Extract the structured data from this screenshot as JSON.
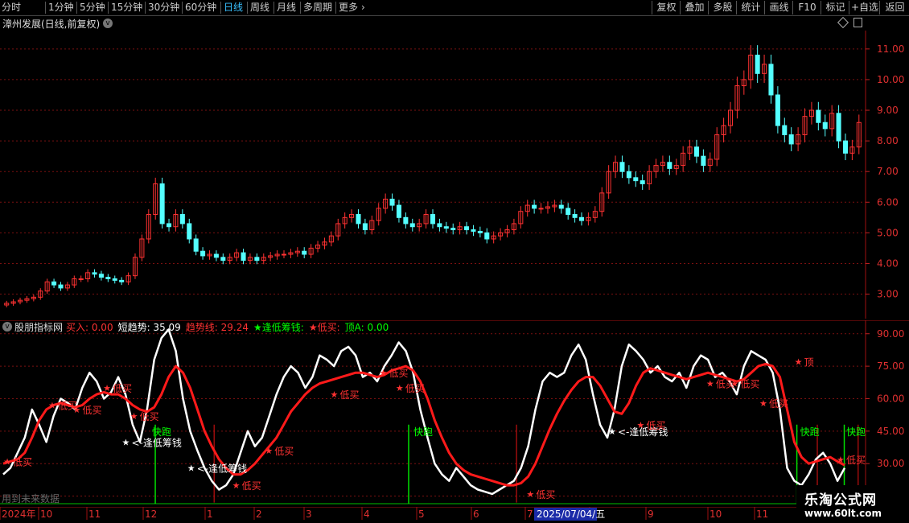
{
  "toolbar": {
    "periods": [
      "分时",
      "1分钟",
      "5分钟",
      "15分钟",
      "30分钟",
      "60分钟",
      "日线",
      "周线",
      "月线",
      "多周期",
      "更多"
    ],
    "active_period": "日线",
    "right_buttons": [
      "复权",
      "叠加",
      "多股",
      "统计",
      "画线",
      "F10",
      "标记",
      "+自选",
      "返回"
    ]
  },
  "main_chart": {
    "title": "漳州发展(日线,前复权)",
    "y_ticks": [
      "11.00",
      "10.00",
      "9.00",
      "8.00",
      "7.00",
      "6.00",
      "5.00",
      "4.00",
      "3.00"
    ],
    "y_range": [
      2.2,
      11.6
    ],
    "close_series": [
      2.7,
      2.75,
      2.8,
      2.85,
      2.9,
      3.1,
      3.4,
      3.3,
      3.2,
      3.3,
      3.5,
      3.5,
      3.7,
      3.65,
      3.55,
      3.5,
      3.45,
      3.4,
      3.6,
      4.2,
      4.8,
      5.6,
      6.6,
      5.3,
      5.2,
      5.6,
      5.3,
      4.8,
      4.4,
      4.25,
      4.3,
      4.2,
      4.1,
      4.2,
      4.35,
      4.1,
      4.2,
      4.1,
      4.2,
      4.25,
      4.3,
      4.3,
      4.35,
      4.4,
      4.3,
      4.5,
      4.6,
      4.7,
      4.9,
      5.3,
      5.5,
      5.6,
      5.3,
      5.1,
      5.4,
      5.8,
      6.1,
      5.9,
      5.5,
      5.3,
      5.2,
      5.3,
      5.6,
      5.3,
      5.2,
      5.15,
      5.1,
      5.2,
      5.1,
      5.05,
      5.0,
      4.8,
      4.9,
      5.0,
      5.1,
      5.3,
      5.7,
      5.9,
      5.8,
      5.8,
      5.85,
      5.9,
      5.8,
      5.6,
      5.5,
      5.4,
      5.5,
      5.7,
      6.3,
      7.0,
      7.3,
      7.0,
      6.8,
      6.7,
      6.6,
      7.0,
      7.2,
      7.3,
      7.1,
      7.2,
      7.6,
      7.8,
      7.5,
      7.2,
      7.4,
      8.2,
      8.5,
      9.0,
      9.8,
      10.0,
      10.8,
      10.2,
      10.5,
      9.5,
      8.5,
      8.2,
      7.9,
      8.2,
      8.8,
      9.0,
      8.6,
      8.4,
      8.9,
      8.0,
      7.6,
      7.8,
      8.6
    ],
    "candle_colors": {
      "up": "#ff3232",
      "down": "#54ffff"
    }
  },
  "indicator": {
    "name": "股朋指标网",
    "legend": [
      {
        "label": "买入: 0.00",
        "color": "#ff3232"
      },
      {
        "label": "短趋势: 35.09",
        "color": "#ffffff"
      },
      {
        "label": "趋势线: 29.24",
        "color": "#ff3232"
      },
      {
        "label": "★逢低筹钱:",
        "color": "#00ff00"
      },
      {
        "label": "★低买:",
        "color": "#ff3232"
      },
      {
        "label": "顶A: 0.00",
        "color": "#00ff00"
      }
    ],
    "y_ticks": [
      "90.00",
      "75.00",
      "60.00",
      "45.00",
      "30.00",
      "15.00"
    ],
    "y_range": [
      10,
      94
    ],
    "short_trend": [
      25,
      28,
      35,
      42,
      55,
      48,
      40,
      52,
      60,
      58,
      55,
      65,
      72,
      68,
      60,
      63,
      70,
      62,
      48,
      40,
      55,
      78,
      88,
      92,
      82,
      60,
      45,
      36,
      28,
      22,
      18,
      20,
      25,
      35,
      45,
      38,
      42,
      52,
      62,
      70,
      75,
      72,
      65,
      70,
      80,
      78,
      75,
      82,
      84,
      80,
      70,
      72,
      68,
      75,
      80,
      86,
      82,
      72,
      55,
      42,
      30,
      25,
      22,
      28,
      24,
      20,
      18,
      17,
      16,
      18,
      20,
      22,
      28,
      38,
      55,
      68,
      72,
      70,
      72,
      80,
      85,
      78,
      62,
      48,
      42,
      55,
      75,
      85,
      82,
      78,
      72,
      75,
      70,
      68,
      72,
      65,
      75,
      80,
      78,
      70,
      72,
      68,
      62,
      75,
      82,
      80,
      78,
      72,
      55,
      28,
      22,
      20,
      25,
      32,
      35,
      30,
      22,
      28
    ],
    "trend_line": [
      30,
      31,
      32,
      35,
      42,
      50,
      55,
      57,
      58,
      57,
      56,
      57,
      60,
      62,
      63,
      62,
      62,
      60,
      57,
      55,
      54,
      56,
      62,
      70,
      75,
      72,
      65,
      55,
      45,
      38,
      32,
      28,
      25,
      25,
      27,
      30,
      34,
      38,
      42,
      48,
      54,
      58,
      62,
      65,
      67,
      68,
      69,
      70,
      71,
      72,
      72,
      71,
      70,
      71,
      73,
      74,
      75,
      73,
      68,
      60,
      50,
      42,
      35,
      30,
      27,
      25,
      24,
      23,
      22,
      21,
      20,
      20,
      21,
      24,
      30,
      38,
      46,
      53,
      59,
      64,
      68,
      70,
      70,
      66,
      60,
      54,
      53,
      58,
      66,
      72,
      74,
      73,
      72,
      71,
      70,
      69,
      70,
      71,
      72,
      71,
      70,
      69,
      68,
      69,
      72,
      75,
      76,
      75,
      70,
      55,
      40,
      33,
      30,
      31,
      32,
      33,
      31,
      29.24
    ],
    "annotations": [
      {
        "text": "低买",
        "color": "#ff3232",
        "x": 0.01,
        "y": 31
      },
      {
        "text": "低买",
        "color": "#ff3232",
        "x": 0.065,
        "y": 57
      },
      {
        "text": "低买",
        "color": "#ff3232",
        "x": 0.095,
        "y": 55
      },
      {
        "text": "低买",
        "color": "#ff3232",
        "x": 0.132,
        "y": 65
      },
      {
        "text": "低买",
        "color": "#ff3232",
        "x": 0.165,
        "y": 52
      },
      {
        "text": "<-逢低筹钱",
        "color": "#ffffff",
        "x": 0.155,
        "y": 40
      },
      {
        "text": "快跑",
        "color": "#00ff00",
        "x": 0.18,
        "y": 45
      },
      {
        "text": "<-逢低筹钱",
        "color": "#ffffff",
        "x": 0.235,
        "y": 28
      },
      {
        "text": "低买",
        "color": "#ff3232",
        "x": 0.29,
        "y": 20
      },
      {
        "text": "低买",
        "color": "#ff3232",
        "x": 0.33,
        "y": 36
      },
      {
        "text": "低买",
        "color": "#ff3232",
        "x": 0.41,
        "y": 62
      },
      {
        "text": "低买",
        "color": "#ff3232",
        "x": 0.47,
        "y": 72
      },
      {
        "text": "低买",
        "color": "#ff3232",
        "x": 0.49,
        "y": 65
      },
      {
        "text": "快跑",
        "color": "#00ff00",
        "x": 0.5,
        "y": 45
      },
      {
        "text": "低买",
        "color": "#ff3232",
        "x": 0.65,
        "y": 16
      },
      {
        "text": "<-逢低筹钱",
        "color": "#ffffff",
        "x": 0.75,
        "y": 45
      },
      {
        "text": "低买",
        "color": "#ff3232",
        "x": 0.785,
        "y": 48
      },
      {
        "text": "低买",
        "color": "#ff3232",
        "x": 0.87,
        "y": 67
      },
      {
        "text": "低买",
        "color": "#ff3232",
        "x": 0.9,
        "y": 67
      },
      {
        "text": "低买",
        "color": "#ff3232",
        "x": 0.935,
        "y": 58
      },
      {
        "text": "顶",
        "color": "#ff3232",
        "x": 0.978,
        "y": 77
      },
      {
        "text": "快跑",
        "color": "#00ff00",
        "x": 0.973,
        "y": 45
      },
      {
        "text": "快跑",
        "color": "#00ff00",
        "x": 1.033,
        "y": 45
      },
      {
        "text": "低买",
        "color": "#ff3232",
        "x": 1.045,
        "y": 32
      }
    ],
    "green_spikes": [
      0.19,
      0.5,
      0.975,
      1.033
    ],
    "red_spikes": [
      0.262,
      0.632,
      1.0,
      1.05
    ],
    "warning": "用到未来数据"
  },
  "x_axis": {
    "labels": [
      "2024年",
      "10",
      "11",
      "12",
      "1",
      "2",
      "3",
      "4",
      "5",
      "6",
      "7",
      "8",
      "9",
      "10",
      "11"
    ],
    "cursor_label": "2025/07/04/五"
  },
  "watermark": {
    "name": "乐淘公式网",
    "url": "www.60lt.com"
  }
}
